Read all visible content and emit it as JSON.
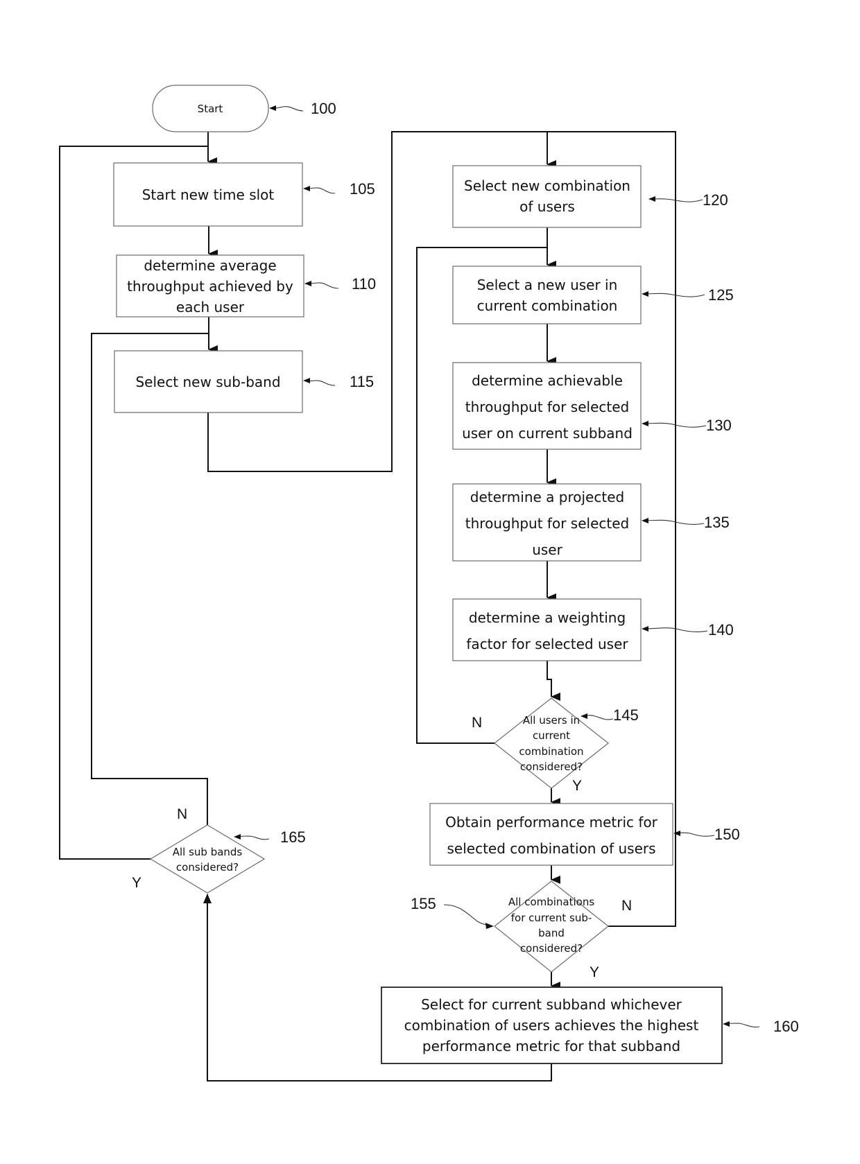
{
  "diagram": {
    "type": "flowchart",
    "nodes": [
      {
        "id": "100",
        "shape": "terminal",
        "lines": [
          "Start"
        ]
      },
      {
        "id": "105",
        "shape": "process",
        "lines": [
          "Start new time slot"
        ]
      },
      {
        "id": "110",
        "shape": "process",
        "lines": [
          "determine average",
          "throughput achieved by",
          "each user"
        ]
      },
      {
        "id": "115",
        "shape": "process",
        "lines": [
          "Select new sub-band"
        ]
      },
      {
        "id": "120",
        "shape": "process",
        "lines": [
          "Select new combination",
          "of users"
        ]
      },
      {
        "id": "125",
        "shape": "process",
        "lines": [
          "Select a new user in",
          "current combination"
        ]
      },
      {
        "id": "130",
        "shape": "process",
        "lines": [
          "determine achievable",
          "throughput for selected",
          "user on current subband"
        ]
      },
      {
        "id": "135",
        "shape": "process",
        "lines": [
          "determine a projected",
          "throughput for selected",
          "user"
        ]
      },
      {
        "id": "140",
        "shape": "process",
        "lines": [
          "determine a weighting",
          "factor for selected user"
        ]
      },
      {
        "id": "145",
        "shape": "decision",
        "lines": [
          "All users in",
          "current",
          "combination",
          "considered?"
        ]
      },
      {
        "id": "150",
        "shape": "process",
        "lines": [
          "Obtain performance metric for",
          "selected combination of users"
        ]
      },
      {
        "id": "155",
        "shape": "decision",
        "lines": [
          "All combinations",
          "for current sub-",
          "band",
          "considered?"
        ]
      },
      {
        "id": "160",
        "shape": "process",
        "lines": [
          "Select for current subband whichever",
          "combination of users achieves the highest",
          "performance metric for that subband"
        ]
      },
      {
        "id": "165",
        "shape": "decision",
        "lines": [
          "All sub bands",
          "considered?"
        ]
      }
    ],
    "edges": [
      {
        "from": "100",
        "to": "105",
        "label": ""
      },
      {
        "from": "105",
        "to": "110",
        "label": ""
      },
      {
        "from": "110",
        "to": "115",
        "label": ""
      },
      {
        "from": "115",
        "to": "120",
        "label": ""
      },
      {
        "from": "120",
        "to": "125",
        "label": ""
      },
      {
        "from": "125",
        "to": "130",
        "label": ""
      },
      {
        "from": "130",
        "to": "135",
        "label": ""
      },
      {
        "from": "135",
        "to": "140",
        "label": ""
      },
      {
        "from": "140",
        "to": "145",
        "label": ""
      },
      {
        "from": "145",
        "to": "125",
        "label": "N"
      },
      {
        "from": "145",
        "to": "150",
        "label": "Y"
      },
      {
        "from": "150",
        "to": "155",
        "label": ""
      },
      {
        "from": "155",
        "to": "120",
        "label": "N"
      },
      {
        "from": "155",
        "to": "160",
        "label": "Y"
      },
      {
        "from": "160",
        "to": "165",
        "label": ""
      },
      {
        "from": "165",
        "to": "115",
        "label": "N"
      },
      {
        "from": "165",
        "to": "105",
        "label": "Y"
      }
    ],
    "reference_numerals": [
      "100",
      "105",
      "110",
      "115",
      "120",
      "125",
      "130",
      "135",
      "140",
      "145",
      "150",
      "155",
      "160",
      "165"
    ],
    "branch_labels": {
      "yes": "Y",
      "no": "N"
    }
  }
}
